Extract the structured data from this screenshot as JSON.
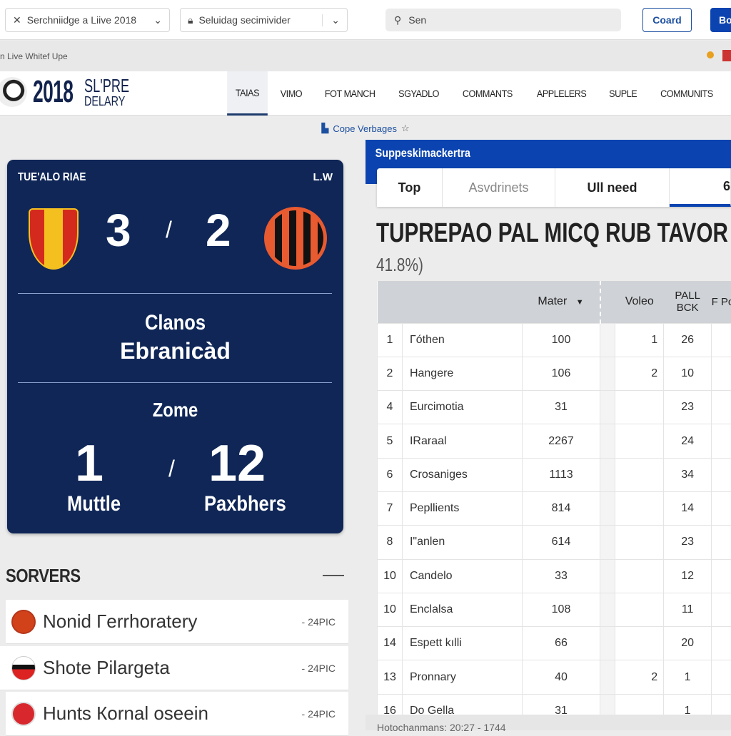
{
  "topbar": {
    "select1": "Serchniidge a Liive 2018",
    "select2": "Seluidag secimivider",
    "search_placeholder": "Sen",
    "button1": "Coard",
    "button2": "Bo"
  },
  "strip": {
    "text": "n Live Whitef Upe"
  },
  "logo": {
    "year": "2018",
    "line1": "SL'PRE",
    "line2": "DELARY"
  },
  "nav": [
    "TAIAS",
    "VIMO",
    "FOT MANCH",
    "SGYADLO",
    "COMMANTS",
    "APPLELERS",
    "SUPLE",
    "COMMUNITS"
  ],
  "subbar": {
    "link": "Cope Verbages"
  },
  "match": {
    "label": "TUE'ALO RIAE",
    "corner": "L.W",
    "home_score": "3",
    "away_score": "2",
    "sep": "/",
    "title1": "Clanos",
    "title2": "Ebranicàd",
    "section": "Zome",
    "left_value": "1",
    "right_value": "12",
    "left_label": "Muttle",
    "right_label": "Paxbhers",
    "colors": {
      "card": "#0f2657"
    }
  },
  "sorvers": {
    "title": "SORVERS",
    "items": [
      {
        "name": "Nonid Гerrhoratery",
        "meta": "- 24PIC"
      },
      {
        "name": "Shote Pilargeta",
        "meta": "- 24PIC"
      },
      {
        "name": "Hunts Кornal oseein",
        "meta": "- 24PIC"
      }
    ]
  },
  "panel": {
    "header": "Suppeskimackertra",
    "tabs": [
      "Top",
      "Asvdrinets",
      "Ull need",
      "6"
    ],
    "title": "TUPREPAO PAL MICQ RUB TAVOR",
    "subtitle": "41.8%)",
    "accent": "#0b44b0"
  },
  "table": {
    "headers": [
      "",
      "",
      "Mater",
      "",
      "Voleo",
      "PALL BCK",
      "F Pos"
    ],
    "rows": [
      [
        "1",
        "Γóthen",
        "100",
        "1",
        "26"
      ],
      [
        "2",
        "Hangere",
        "106",
        "2",
        "10"
      ],
      [
        "4",
        "Eurcimotia",
        "31",
        "",
        "23"
      ],
      [
        "5",
        "IRaraal",
        "2267",
        "",
        "24"
      ],
      [
        "6",
        "Crosaniges",
        "1113",
        "",
        "34"
      ],
      [
        "7",
        "Pepllients",
        "814",
        "",
        "14"
      ],
      [
        "8",
        "I\"anlen",
        "614",
        "",
        "23"
      ],
      [
        "10",
        "Candelo",
        "33",
        "",
        "12"
      ],
      [
        "10",
        "Enclalsa",
        "108",
        "",
        "11"
      ],
      [
        "14",
        "Espett kılli",
        "66",
        "",
        "20"
      ],
      [
        "13",
        "Pronnary",
        "40",
        "2",
        "1"
      ],
      [
        "16",
        "Do Gella",
        "31",
        "",
        "1"
      ]
    ]
  },
  "footer": "Hotochanmans: 20:27 - 1744"
}
